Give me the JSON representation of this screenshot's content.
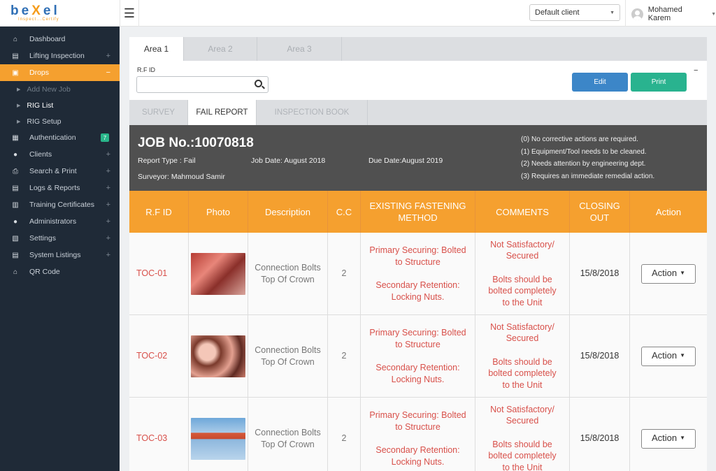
{
  "app": {
    "logo_text_1": "be",
    "logo_text_x": "X",
    "logo_text_2": "el",
    "logo_tagline": "Inspect...Certify"
  },
  "header": {
    "client_select": "Default client",
    "user_name": "Mohamed Karem"
  },
  "sidebar": {
    "items": [
      {
        "label": "Dashboard",
        "icon": "home-icon"
      },
      {
        "label": "Lifting Inspection",
        "icon": "clipboard-icon"
      },
      {
        "label": "Drops",
        "icon": "document-icon"
      },
      {
        "label": "Authentication",
        "icon": "building-icon",
        "badge": "7"
      },
      {
        "label": "Clients",
        "icon": "users-icon"
      },
      {
        "label": "Search & Print",
        "icon": "printer-icon"
      },
      {
        "label": "Logs & Reports",
        "icon": "file-icon"
      },
      {
        "label": "Training Certificates",
        "icon": "certificate-icon"
      },
      {
        "label": "Administrators",
        "icon": "user-icon"
      },
      {
        "label": "Settings",
        "icon": "settings-icon"
      },
      {
        "label": "System Listings",
        "icon": "list-icon"
      },
      {
        "label": "QR Code",
        "icon": "home-icon"
      }
    ],
    "sub_items": [
      {
        "label": "Add New Job"
      },
      {
        "label": "RIG List"
      },
      {
        "label": "RIG Setup"
      }
    ],
    "plus": "+",
    "minus": "−"
  },
  "area_tabs": [
    "Area 1",
    "Area 2",
    "Area 3"
  ],
  "rf_panel": {
    "label": "R.F ID",
    "value": "",
    "edit_label": "Edit",
    "print_label": "Print",
    "collapse": "−"
  },
  "report_tabs": [
    "SURVEY",
    "FAIL REPORT",
    "INSPECTION BOOK"
  ],
  "job": {
    "title": "JOB No.:10070818",
    "report_type": "Report Type : Fail",
    "job_date": "Job Date: August 2018",
    "due_date": "Due Date:August 2019",
    "surveyor": "Surveyor: Mahmoud Samir",
    "legend": [
      "(0) No corrective actions are required.",
      "(1) Equipment/Tool needs to be cleaned.",
      "(2) Needs attention by engineering dept.",
      "(3) Requires an immediate remedial action."
    ]
  },
  "table": {
    "columns": [
      "R.F ID",
      "Photo",
      "Description",
      "C.C",
      "EXISTING FASTENING METHOD",
      "COMMENTS",
      "CLOSING OUT",
      "Action"
    ],
    "rows": [
      {
        "rfid": "TOC-01",
        "description": "Connection Bolts Top Of Crown",
        "cc": "2",
        "fastening_1": "Primary Securing: Bolted to Structure",
        "fastening_2": "Secondary Retention: Locking  Nuts.",
        "comment_1": "Not Satisfactory/ Secured",
        "comment_2": "Bolts should be bolted completely to the Unit",
        "closing_out": "15/8/2018",
        "action": "Action"
      },
      {
        "rfid": "TOC-02",
        "description": "Connection Bolts Top Of Crown",
        "cc": "2",
        "fastening_1": "Primary Securing: Bolted to Structure",
        "fastening_2": "Secondary Retention: Locking  Nuts.",
        "comment_1": "Not Satisfactory/ Secured",
        "comment_2": "Bolts should be bolted completely to the Unit",
        "closing_out": "15/8/2018",
        "action": "Action"
      },
      {
        "rfid": "TOC-03",
        "description": "Connection Bolts Top Of Crown",
        "cc": "2",
        "fastening_1": "Primary Securing: Bolted to Structure",
        "fastening_2": "Secondary Retention: Locking  Nuts.",
        "comment_1": "Not Satisfactory/ Secured",
        "comment_2": "Bolts should be bolted completely to the Unit",
        "closing_out": "15/8/2018",
        "action": "Action"
      }
    ]
  },
  "colors": {
    "accent": "#f5a02f",
    "sidebar_bg": "#1f2a37",
    "edit_button": "#3c86c8",
    "print_button": "#29b38f",
    "job_header_bg": "#505050",
    "danger_text": "#d8504a"
  }
}
